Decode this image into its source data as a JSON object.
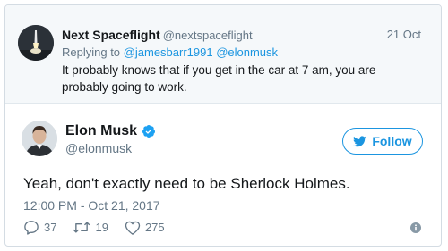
{
  "parent_tweet": {
    "name": "Next Spaceflight",
    "handle": "@nextspaceflight",
    "date": "21 Oct",
    "replying_prefix": "Replying to",
    "replying_to": "@jamesbarr1991 @elonmusk",
    "text": "It probably knows that if you get in the car at 7 am, you are probably going to work."
  },
  "tweet": {
    "name": "Elon Musk",
    "handle": "@elonmusk",
    "follow_label": "Follow",
    "text": "Yeah, don't exactly need to be Sherlock Holmes.",
    "timestamp": "12:00 PM - Oct 21, 2017",
    "replies": "37",
    "retweets": "19",
    "likes": "275"
  },
  "icons": {
    "verified": "verified-badge-icon",
    "follow": "twitter-bird-icon",
    "reply": "reply-icon",
    "retweet": "retweet-icon",
    "like": "heart-icon",
    "info": "info-icon"
  },
  "colors": {
    "accent": "#1b95e0",
    "muted": "#657786",
    "text": "#14171a",
    "parent_bg": "#f5f8fa"
  }
}
